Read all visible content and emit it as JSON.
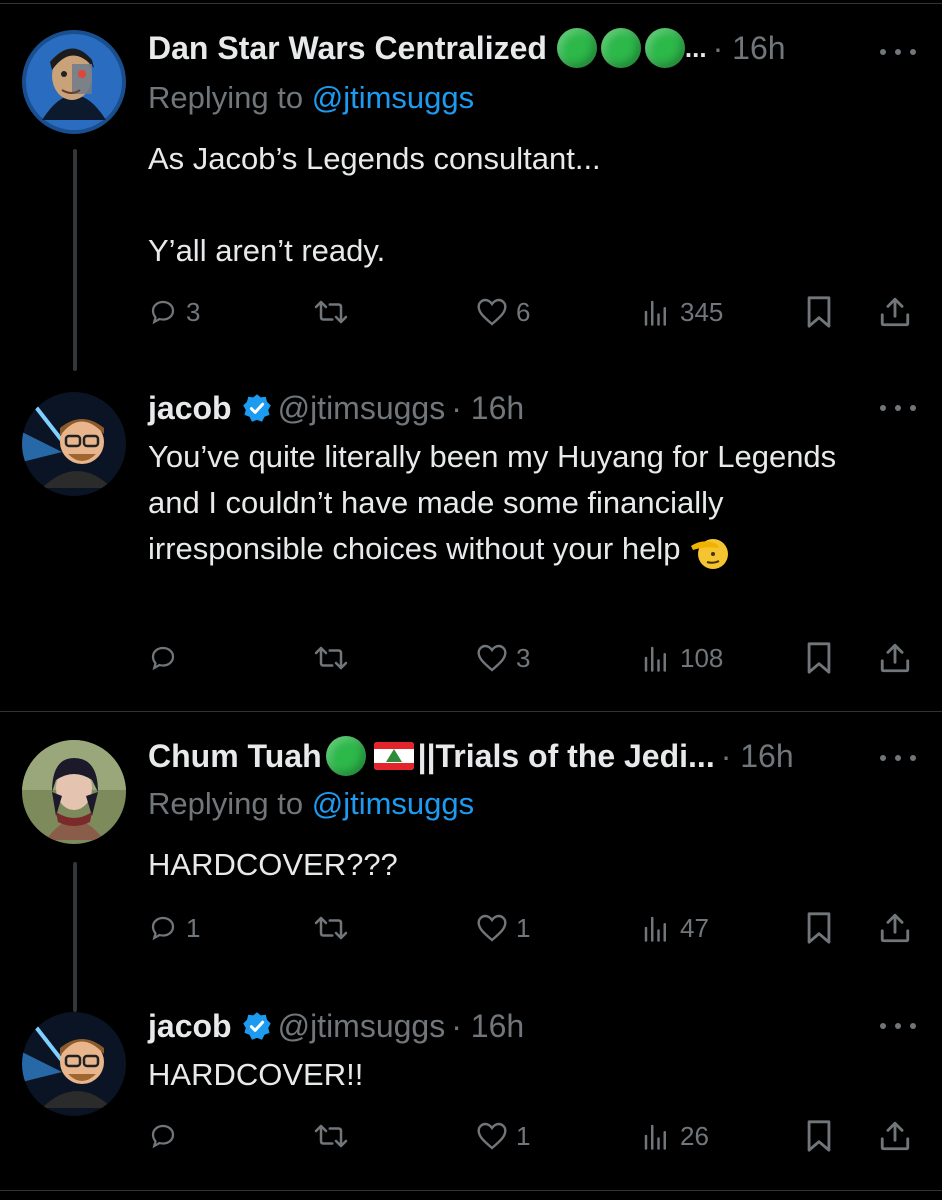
{
  "posts": [
    {
      "name": "Dan Star Wars Centralized",
      "name_suffix": "...",
      "time": "· 16h",
      "replying_prefix": "Replying to",
      "replying_handle": "@jtimsuggs",
      "text_line1": "As Jacob’s Legends consultant...",
      "text_line2": "Y’all aren’t ready.",
      "replies": "3",
      "likes": "6",
      "views": "345"
    },
    {
      "name": "jacob",
      "handle": "@jtimsuggs",
      "time": "· 16h",
      "text": "You’ve quite literally been my Huyang for Legends and I couldn’t have made some financially irresponsible choices without your help",
      "replies": "",
      "likes": "3",
      "views": "108"
    },
    {
      "name": "Chum Tuah",
      "name_suffix": "||Trials of the Jedi...",
      "time": "· 16h",
      "replying_prefix": "Replying to",
      "replying_handle": "@jtimsuggs",
      "text": "HARDCOVER???",
      "replies": "1",
      "likes": "1",
      "views": "47"
    },
    {
      "name": "jacob",
      "handle": "@jtimsuggs",
      "time": "· 16h",
      "text": "HARDCOVER!!",
      "replies": "",
      "likes": "1",
      "views": "26"
    }
  ],
  "icons": {
    "reply": "reply-icon",
    "retweet": "retweet-icon",
    "like": "heart-icon",
    "views": "views-icon",
    "bookmark": "bookmark-icon",
    "share": "share-icon",
    "more": "more-icon",
    "verified": "verified-badge-icon"
  },
  "colors": {
    "background": "#000000",
    "text": "#e7e9ea",
    "muted": "#71767b",
    "link": "#1d9bf0",
    "verified": "#1d9bf0",
    "green_dot": "#2db84a"
  }
}
